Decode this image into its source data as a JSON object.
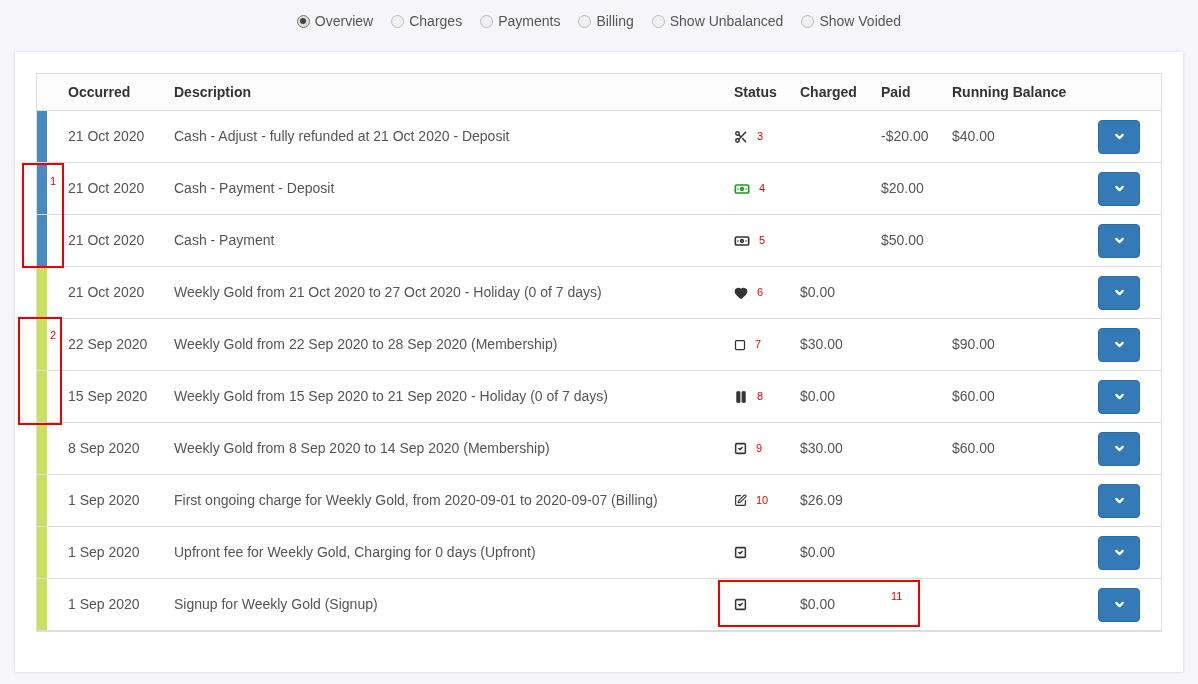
{
  "view_options": [
    {
      "label": "Overview",
      "selected": true
    },
    {
      "label": "Charges",
      "selected": false
    },
    {
      "label": "Payments",
      "selected": false
    },
    {
      "label": "Billing",
      "selected": false
    },
    {
      "label": "Show Unbalanced",
      "selected": false
    },
    {
      "label": "Show Voided",
      "selected": false
    }
  ],
  "table": {
    "columns": [
      "Occurred",
      "Description",
      "Status",
      "Charged",
      "Paid",
      "Running Balance"
    ],
    "rows": [
      {
        "color": "#4a89c0",
        "occurred": "21 Oct 2020",
        "description": "Cash - Adjust - fully refunded at 21 Oct 2020 - Deposit",
        "kind": "refunded",
        "note": "3",
        "charged": "",
        "paid": "-$20.00",
        "running_balance": "$40.00"
      },
      {
        "color": "#4a89c0",
        "occurred": "21 Oct 2020",
        "description": "Cash - Payment - Deposit",
        "kind": "deposit",
        "note": "4",
        "charged": "",
        "paid": "$20.00",
        "running_balance": ""
      },
      {
        "color": "#4a89c0",
        "occurred": "21 Oct 2020",
        "description": "Cash - Payment",
        "kind": "payment",
        "note": "5",
        "charged": "",
        "paid": "$50.00",
        "running_balance": ""
      },
      {
        "color": "#cbdf61",
        "occurred": "21 Oct 2020",
        "description": "Weekly Gold from 21 Oct 2020 to 27 Oct 2020 - Holiday (0 of 7 days)",
        "kind": "holiday",
        "note": "6",
        "charged": "$0.00",
        "paid": "",
        "running_balance": ""
      },
      {
        "color": "#cbdf61",
        "occurred": "22 Sep 2020",
        "description": "Weekly Gold from 22 Sep 2020 to 28 Sep 2020 (Membership)",
        "kind": "pending",
        "note": "7",
        "charged": "$30.00",
        "paid": "",
        "running_balance": "$90.00"
      },
      {
        "color": "#cbdf61",
        "occurred": "15 Sep 2020",
        "description": "Weekly Gold from 15 Sep 2020 to 21 Sep 2020 - Holiday (0 of 7 days)",
        "kind": "paused",
        "note": "8",
        "charged": "$0.00",
        "paid": "",
        "running_balance": "$60.00"
      },
      {
        "color": "#cbdf61",
        "occurred": "8 Sep 2020",
        "description": "Weekly Gold from 8 Sep 2020 to 14 Sep 2020 (Membership)",
        "kind": "done",
        "note": "9",
        "charged": "$30.00",
        "paid": "",
        "running_balance": "$60.00"
      },
      {
        "color": "#cbdf61",
        "occurred": "1 Sep 2020",
        "description": "First ongoing charge for Weekly Gold, from 2020-09-01 to 2020-09-07 (Billing)",
        "kind": "billed",
        "note": "10",
        "charged": "$26.09",
        "paid": "",
        "running_balance": ""
      },
      {
        "color": "#cbdf61",
        "occurred": "1 Sep 2020",
        "description": "Upfront fee for Weekly Gold, Charging for 0 days (Upfront)",
        "kind": "done",
        "note": "",
        "charged": "$0.00",
        "paid": "",
        "running_balance": ""
      },
      {
        "color": "#cbdf61",
        "occurred": "1 Sep 2020",
        "description": "Signup for Weekly Gold (Signup)",
        "kind": "done",
        "note": "",
        "charged": "$0.00",
        "paid": "",
        "running_balance": ""
      }
    ]
  },
  "annotations": [
    {
      "label": "1"
    },
    {
      "label": "2"
    },
    {
      "label": "11"
    }
  ]
}
